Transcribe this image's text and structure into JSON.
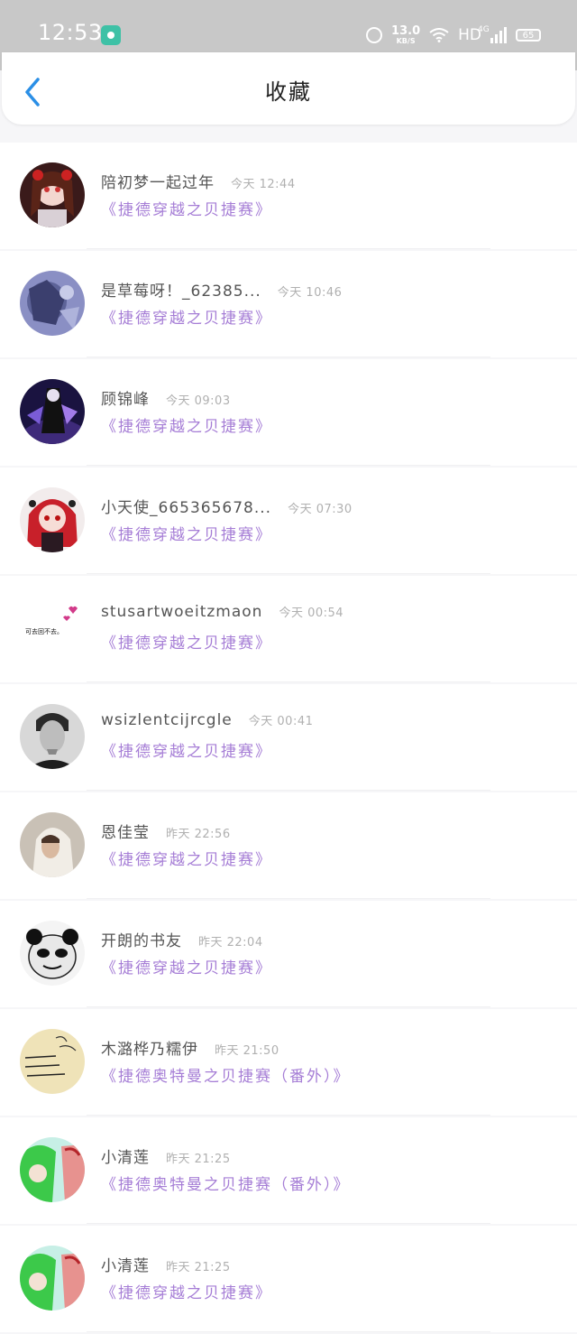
{
  "status_bar": {
    "time": "12:53",
    "net_speed": "13.0",
    "net_unit": "KB/S",
    "hd": "HD",
    "signal_label": "4G",
    "battery": "65"
  },
  "header": {
    "title": "收藏",
    "back_icon": "chevron-left-icon",
    "accent_color": "#2b8fe6"
  },
  "colors": {
    "novel_title": "#a67ed6",
    "timestamp": "#b0b0b0"
  },
  "favorites": [
    {
      "name": "陪初梦一起过年",
      "time": "今天 12:44",
      "novel": "《捷德穿越之贝捷赛》",
      "avatar": "anime-girl-red-avatar"
    },
    {
      "name": "是草莓呀！_62385...",
      "time": "今天 10:46",
      "novel": "《捷德穿越之贝捷赛》",
      "avatar": "blue-wolf-avatar"
    },
    {
      "name": "顾锦峰",
      "time": "今天 09:03",
      "novel": "《捷德穿越之贝捷赛》",
      "avatar": "purple-warrior-avatar"
    },
    {
      "name": "小天使_665365678...",
      "time": "今天 07:30",
      "novel": "《捷德穿越之贝捷赛》",
      "avatar": "red-hair-girl-avatar"
    },
    {
      "name": "stusartwoeitzmaon",
      "time": "今天 00:54",
      "novel": "《捷德穿越之贝捷赛》",
      "avatar": "hearts-text-avatar",
      "avatar_text": "可去回不去。"
    },
    {
      "name": "wsizlentcijrcgle",
      "time": "今天 00:41",
      "novel": "《捷德穿越之贝捷赛》",
      "avatar": "bw-man-avatar"
    },
    {
      "name": "恩佳莹",
      "time": "昨天 22:56",
      "novel": "《捷德穿越之贝捷赛》",
      "avatar": "hooded-person-avatar"
    },
    {
      "name": "开朗的书友",
      "time": "昨天 22:04",
      "novel": "《捷德穿越之贝捷赛》",
      "avatar": "panda-meme-avatar"
    },
    {
      "name": "木潞桦乃糯伊",
      "time": "昨天 21:50",
      "novel": "《捷德奥特曼之贝捷赛（番外）》",
      "avatar": "handwriting-avatar"
    },
    {
      "name": "小清莲",
      "time": "昨天 21:25",
      "novel": "《捷德奥特曼之贝捷赛（番外）》",
      "avatar": "green-hair-avatar"
    },
    {
      "name": "小清莲",
      "time": "昨天 21:25",
      "novel": "《捷德穿越之贝捷赛》",
      "avatar": "green-hair-avatar"
    }
  ]
}
